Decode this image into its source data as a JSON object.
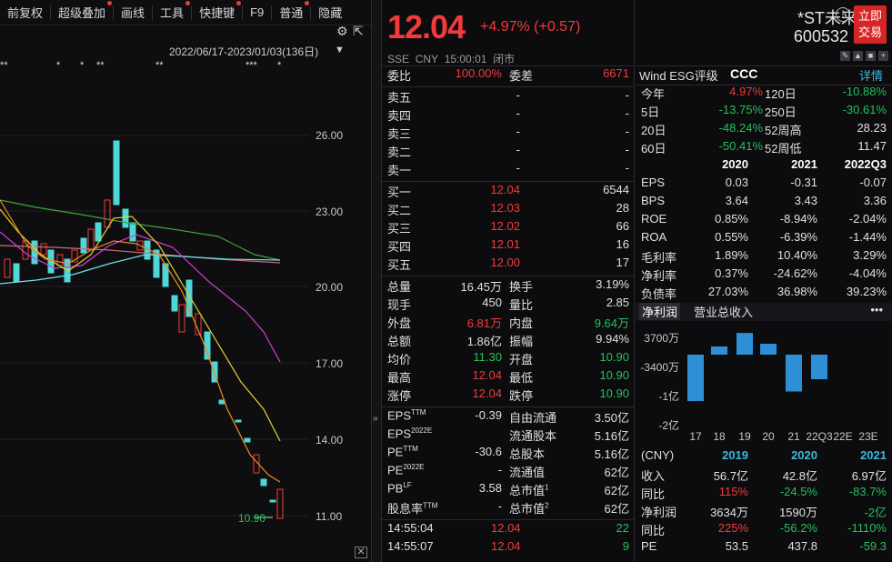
{
  "toolbar": [
    "前复权",
    "超级叠加",
    "画线",
    "工具",
    "快捷键",
    "F9",
    "普通",
    "隐藏"
  ],
  "chart": {
    "range": "2022/06/17-2023/01/03(136日)",
    "price_labels": [
      "26.00",
      "23.00",
      "20.00",
      "17.00",
      "14.00",
      "11.00"
    ],
    "last_price_label": "10.90"
  },
  "quote": {
    "price": "12.04",
    "change": "+4.97% (+0.57)",
    "exchange": "SSE",
    "currency": "CNY",
    "time": "15:00:01",
    "status": "闭市",
    "committee": [
      [
        "委比",
        "100.00%"
      ],
      [
        "委差",
        "6671"
      ]
    ],
    "asks": [
      [
        "卖五",
        "-",
        "-"
      ],
      [
        "卖四",
        "-",
        "-"
      ],
      [
        "卖三",
        "-",
        "-"
      ],
      [
        "卖二",
        "-",
        "-"
      ],
      [
        "卖一",
        "-",
        "-"
      ]
    ],
    "bids": [
      [
        "买一",
        "12.04",
        "6544"
      ],
      [
        "买二",
        "12.03",
        "28"
      ],
      [
        "买三",
        "12.02",
        "66"
      ],
      [
        "买四",
        "12.01",
        "16"
      ],
      [
        "买五",
        "12.00",
        "17"
      ]
    ],
    "stats": [
      [
        "总量",
        "16.45万",
        "换手",
        "3.19%"
      ],
      [
        "现手",
        "450",
        "量比",
        "2.85"
      ],
      [
        "外盘",
        "6.81万",
        "内盘",
        "9.64万"
      ],
      [
        "总额",
        "1.86亿",
        "振幅",
        "9.94%"
      ],
      [
        "均价",
        "11.30",
        "开盘",
        "10.90"
      ],
      [
        "最高",
        "12.04",
        "最低",
        "10.90"
      ],
      [
        "涨停",
        "12.04",
        "跌停",
        "10.90"
      ]
    ],
    "fund": [
      [
        "EPS",
        "TTM",
        "-0.39",
        "自由流通",
        "3.50亿"
      ],
      [
        "EPS",
        "2022E",
        "",
        "流通股本",
        "5.16亿"
      ],
      [
        "PE",
        "TTM",
        "-30.6",
        "总股本",
        "5.16亿"
      ],
      [
        "PE",
        "2022E",
        "-",
        "流通值",
        "62亿"
      ],
      [
        "PB",
        "LF",
        "3.58",
        "总市值",
        "62亿"
      ],
      [
        "股息率",
        "TTM",
        "-",
        "总市值",
        "62亿"
      ]
    ],
    "fund_sup": [
      "",
      "",
      "",
      "",
      "1",
      "2"
    ],
    "ticks": [
      [
        "14:55:04",
        "12.04",
        "22"
      ],
      [
        "14:55:07",
        "12.04",
        "9"
      ]
    ]
  },
  "right": {
    "name": "*ST未来",
    "code": "600532",
    "trade": [
      "立即",
      "交易"
    ],
    "esg_label": "Wind ESG评级",
    "esg_value": "CCC",
    "detail": "详情",
    "perf": [
      [
        "今年",
        "4.97%",
        "120日",
        "-10.88%"
      ],
      [
        "5日",
        "-13.75%",
        "250日",
        "-30.61%"
      ],
      [
        "20日",
        "-48.24%",
        "52周高",
        "28.23"
      ],
      [
        "60日",
        "-50.41%",
        "52周低",
        "11.47"
      ]
    ],
    "fin_head": [
      "2020",
      "2021",
      "2022Q3"
    ],
    "fin": [
      [
        "EPS",
        "0.03",
        "-0.31",
        "-0.07"
      ],
      [
        "BPS",
        "3.64",
        "3.43",
        "3.36"
      ],
      [
        "ROE",
        "0.85%",
        "-8.94%",
        "-2.04%"
      ],
      [
        "ROA",
        "0.55%",
        "-6.39%",
        "-1.44%"
      ],
      [
        "毛利率",
        "1.89%",
        "10.40%",
        "3.29%"
      ],
      [
        "净利率",
        "0.37%",
        "-24.62%",
        "-4.04%"
      ],
      [
        "负债率",
        "27.03%",
        "36.98%",
        "39.23%"
      ]
    ],
    "tabs": [
      "净利润",
      "营业总收入"
    ],
    "bar_axis": [
      "3700万",
      "-3400万",
      "-1亿",
      "-2亿"
    ],
    "bar_x": [
      "17",
      "18",
      "19",
      "20",
      "21",
      "22Q3",
      "22E",
      "23E"
    ],
    "bar_values_wan": [
      -3400,
      600,
      1590,
      800,
      -2700,
      -1800
    ],
    "annual_head": [
      "(CNY)",
      "2019",
      "2020",
      "2021"
    ],
    "annual": [
      [
        "收入",
        "56.7亿",
        "42.8亿",
        "6.97亿"
      ],
      [
        "同比",
        "115%",
        "-24.5%",
        "-83.7%"
      ],
      [
        "净利润",
        "3634万",
        "1590万",
        "-2亿"
      ],
      [
        "同比",
        "225%",
        "-56.2%",
        "-1110%"
      ],
      [
        "PE",
        "53.5",
        "437.8",
        "-59.3"
      ]
    ]
  }
}
